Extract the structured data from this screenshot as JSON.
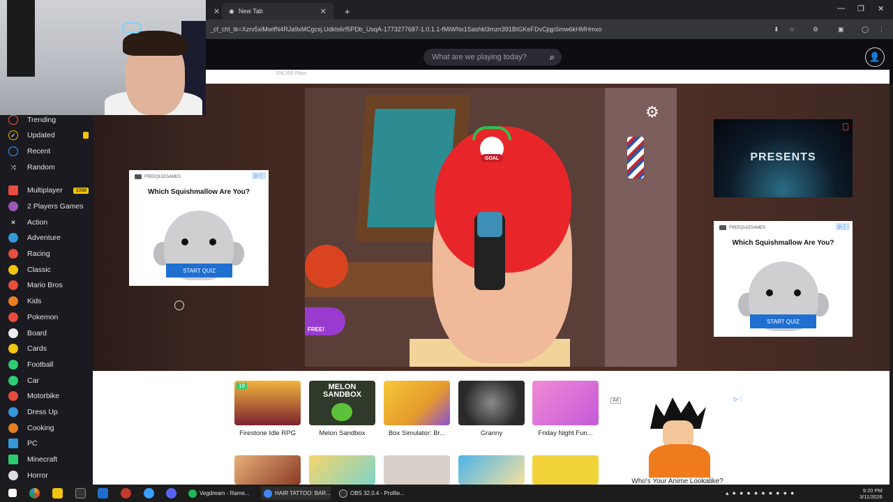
{
  "browser": {
    "tabs": [
      {
        "label": "New Tab"
      }
    ],
    "url": "_cf_chl_tk=Xzrv5xlMwifN4RJa9xMCgcsj.Udkls6rf5PDb_UsqA-1773277687-1.0.1.1-fMiWNx1Sashkl3mzn391BtGKeFDvCjqpSmw6kHMHmxo"
  },
  "site": {
    "search_placeholder": "What are we playing today?",
    "plays_text": "156,355 Plays"
  },
  "sidebar": {
    "items": [
      {
        "label": "Trending",
        "icon": "flame-icon",
        "color": "#ff5a3d"
      },
      {
        "label": "Updated",
        "icon": "check-icon",
        "color": "#f1b800",
        "badge_dot": true
      },
      {
        "label": "Recent",
        "icon": "clock-icon",
        "color": "#3aa0ff"
      },
      {
        "label": "Random",
        "icon": "shuffle-icon",
        "color": "#cccccc"
      },
      {
        "label": "Multiplayer",
        "icon": "grid-icon",
        "color": "#e74c3c",
        "badge": "1098"
      },
      {
        "label": "2 Players Games",
        "icon": "controller-icon",
        "color": "#9b59b6"
      },
      {
        "label": "Action",
        "icon": "swords-icon",
        "color": "#dddddd"
      },
      {
        "label": "Adventure",
        "icon": "compass-icon",
        "color": "#3498db"
      },
      {
        "label": "Racing",
        "icon": "car-icon",
        "color": "#e74c3c"
      },
      {
        "label": "Classic",
        "icon": "pacman-icon",
        "color": "#f1c40f"
      },
      {
        "label": "Mario Bros",
        "icon": "mario-icon",
        "color": "#e74c3c"
      },
      {
        "label": "Kids",
        "icon": "kids-icon",
        "color": "#e67e22"
      },
      {
        "label": "Pokemon",
        "icon": "pokeball-icon",
        "color": "#e74c3c"
      },
      {
        "label": "Board",
        "icon": "board-icon",
        "color": "#ecf0f1"
      },
      {
        "label": "Cards",
        "icon": "cards-icon",
        "color": "#f1c40f"
      },
      {
        "label": "Football",
        "icon": "football-icon",
        "color": "#2ecc71"
      },
      {
        "label": "Car",
        "icon": "car-icon",
        "color": "#2ecc71"
      },
      {
        "label": "Motorbike",
        "icon": "motorbike-icon",
        "color": "#e74c3c"
      },
      {
        "label": "Dress Up",
        "icon": "dress-icon",
        "color": "#3498db"
      },
      {
        "label": "Cooking",
        "icon": "cooking-icon",
        "color": "#e67e22"
      },
      {
        "label": "PC",
        "icon": "pc-icon",
        "color": "#3498db"
      },
      {
        "label": "Minecraft",
        "icon": "minecraft-icon",
        "color": "#2ecc71"
      },
      {
        "label": "Horror",
        "icon": "horror-icon",
        "color": "#dddddd"
      }
    ]
  },
  "game": {
    "goal_label": "GOAL",
    "free_label": "FREE!"
  },
  "ads": {
    "brand": "FREEQUIZGAMES",
    "quiz_title": "Which Squishmallow Are You?",
    "quiz_button": "START QUIZ",
    "presents_text": "PRESENTS",
    "ad_tag": "Ad",
    "goku_caption": "Who's Your Anime Lookalike?"
  },
  "games_row": [
    {
      "label": "Firestone Idle RPG",
      "color": "#7a2430",
      "badge": "19"
    },
    {
      "label": "Melon Sandbox",
      "color": "#2f3a2a",
      "thumb_text": "MELON SANDBOX"
    },
    {
      "label": "Box Simulator: Br...",
      "color": "#e59a2b"
    },
    {
      "label": "Granny",
      "color": "#3a3a3a"
    },
    {
      "label": "Friday Night Fun...",
      "color": "#c45ad8"
    }
  ],
  "games_row2_colors": [
    "#c4793a",
    "#7fd3c8",
    "#d8cfc8",
    "#4db4e8",
    "#f2d43a"
  ],
  "taskbar": {
    "apps": [
      {
        "label": "Vegdream - Rame...",
        "color": "#1db954"
      },
      {
        "label": "HAIR TATTOO: BAR...",
        "color": "#4285f4"
      },
      {
        "label": "OBS 32.0.4 - Profile...",
        "color": "#302e31"
      }
    ],
    "time": "9:20 PM",
    "date": "3/11/2026"
  }
}
